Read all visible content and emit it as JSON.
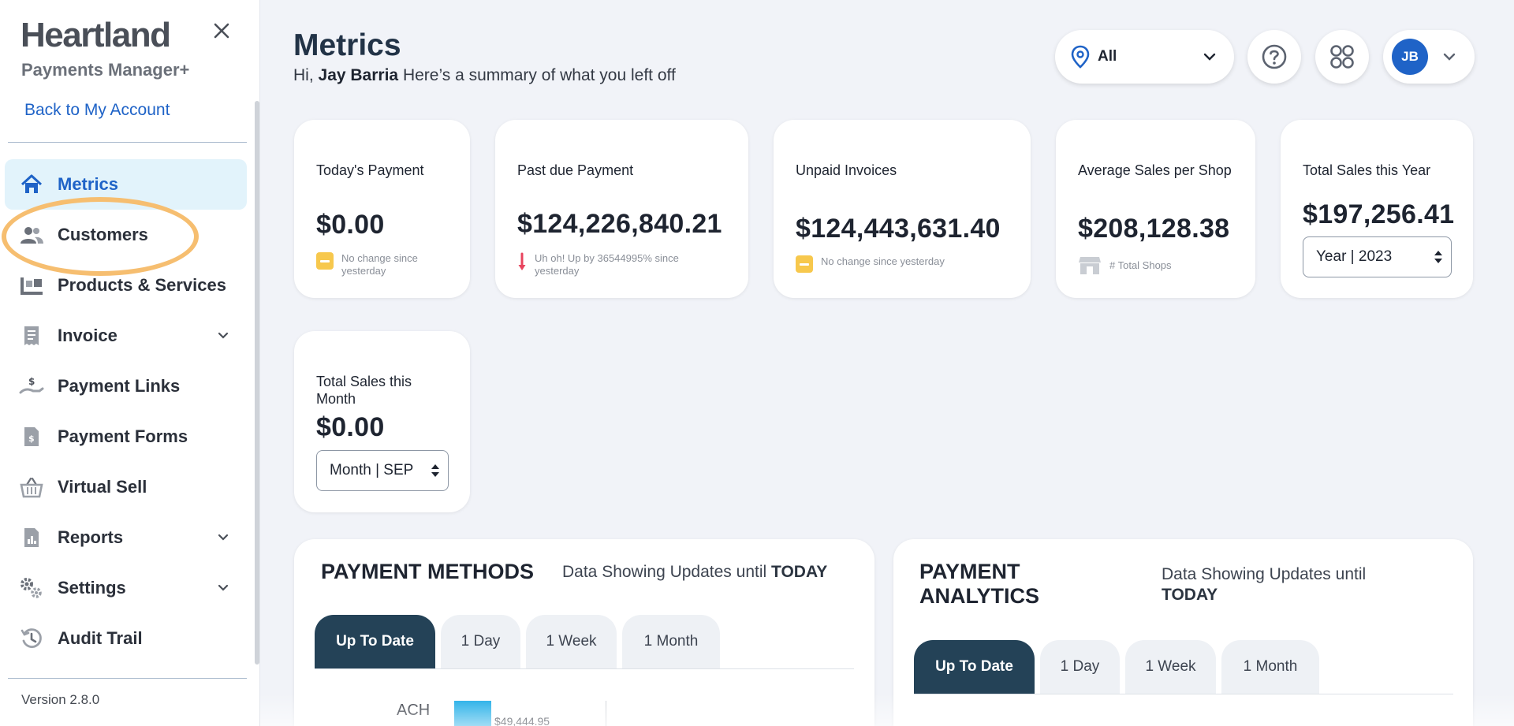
{
  "sidebar": {
    "brand": "Heartland",
    "brand_sub": "Payments Manager+",
    "back_link": "Back to My Account",
    "version": "Version 2.8.0",
    "items": [
      {
        "label": "Metrics",
        "icon": "home-icon",
        "active": true
      },
      {
        "label": "Customers",
        "icon": "users-icon"
      },
      {
        "label": "Products & Services",
        "icon": "products-icon"
      },
      {
        "label": "Invoice",
        "icon": "receipt-icon",
        "expandable": true
      },
      {
        "label": "Payment Links",
        "icon": "hand-dollar-icon"
      },
      {
        "label": "Payment Forms",
        "icon": "document-dollar-icon"
      },
      {
        "label": "Virtual Sell",
        "icon": "basket-icon"
      },
      {
        "label": "Reports",
        "icon": "chart-document-icon",
        "expandable": true
      },
      {
        "label": "Settings",
        "icon": "gears-icon",
        "expandable": true
      },
      {
        "label": "Audit Trail",
        "icon": "history-icon"
      }
    ]
  },
  "header": {
    "title": "Metrics",
    "greeting_prefix": "Hi,",
    "user_name": "Jay Barria",
    "greeting_suffix": "Here’s a summary of what you left off",
    "location": "All",
    "avatar_initials": "JB"
  },
  "cards": {
    "todays_payment": {
      "title": "Today's Payment",
      "value": "$0.00",
      "note": "No change since yesterday"
    },
    "past_due": {
      "title": "Past due Payment",
      "value": "$124,226,840.21",
      "note": "Uh oh! Up by 36544995% since yesterday"
    },
    "unpaid": {
      "title": "Unpaid Invoices",
      "value": "$124,443,631.40",
      "note": "No change since yesterday"
    },
    "avg_sales": {
      "title": "Average Sales per Shop",
      "value": "$208,128.38",
      "note": "# Total Shops"
    },
    "total_year": {
      "title": "Total Sales this Year",
      "value": "$197,256.41",
      "select": "Year | 2023"
    },
    "total_month": {
      "title": "Total Sales this Month",
      "value": "$0.00",
      "select": "Month | SEP"
    }
  },
  "payment_methods": {
    "title": "PAYMENT METHODS",
    "sub_prefix": "Data Showing Updates until",
    "sub_bold": "TODAY",
    "tabs": [
      "Up To Date",
      "1 Day",
      "1 Week",
      "1 Month"
    ],
    "active_tab": 0
  },
  "payment_analytics": {
    "title_line1": "PAYMENT",
    "title_line2": "ANALYTICS",
    "sub_line1": "Data Showing Updates until",
    "sub_bold": "TODAY",
    "tabs": [
      "Up To Date",
      "1 Day",
      "1 Week",
      "1 Month"
    ],
    "active_tab": 0
  },
  "chart_data": {
    "type": "bar",
    "categories": [
      "ACH"
    ],
    "values": [
      49444.95
    ],
    "value_labels": [
      "$49,444.95"
    ]
  },
  "colors": {
    "accent": "#1f63c7",
    "active_bg": "#e2f3fb",
    "tab_active": "#244257",
    "bar": "#14a9e6",
    "warning": "#f7c84d",
    "alert": "#e8445e",
    "highlight_ring": "#f6be70"
  }
}
